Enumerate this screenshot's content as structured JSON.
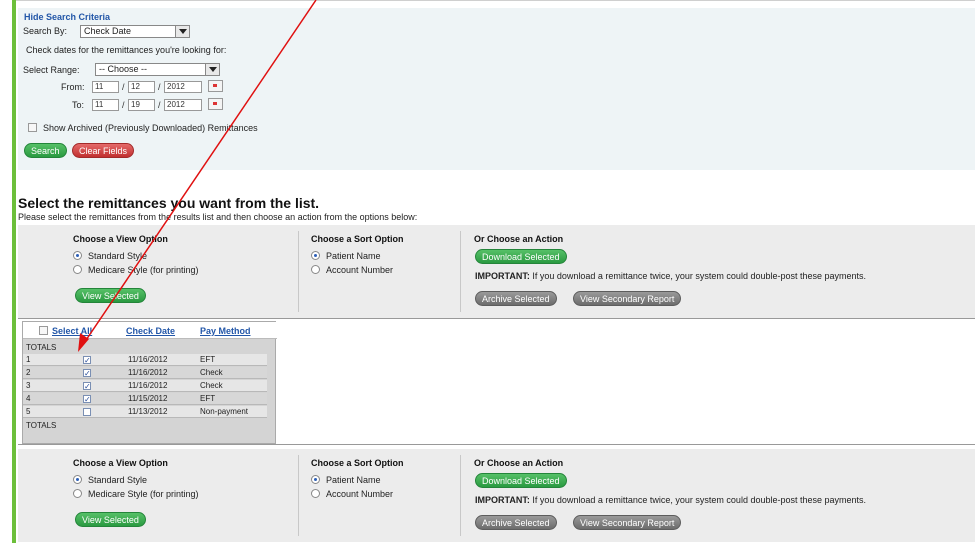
{
  "search": {
    "hide_link": "Hide Search Criteria",
    "search_by_label": "Search By:",
    "search_by_value": "Check Date",
    "check_dates_text": "Check dates for the remittances you're looking for:",
    "select_range_label": "Select Range:",
    "select_range_value": "-- Choose --",
    "from_label": "From:",
    "to_label": "To:",
    "from_month": "11",
    "from_day": "12",
    "from_year": "2012",
    "to_month": "11",
    "to_day": "19",
    "to_year": "2012",
    "slash": "/",
    "archived_label": "Show Archived (Previously Downloaded) Remittances",
    "search_button": "Search",
    "clear_button": "Clear Fields"
  },
  "section": {
    "title": "Select the remittances you want from the list.",
    "subtitle": "Please select the remittances from the results list and then choose an action from the options below:"
  },
  "options": {
    "view_heading": "Choose a View Option",
    "view_options": [
      "Standard Style",
      "Medicare Style (for printing)"
    ],
    "view_button": "View Selected",
    "sort_heading": "Choose a Sort Option",
    "sort_options": [
      "Patient Name",
      "Account Number"
    ],
    "action_heading": "Or Choose an Action",
    "download_button": "Download Selected",
    "important_label": "IMPORTANT:",
    "important_text": "If you download a remittance twice, your system could double-post these payments.",
    "archive_button": "Archive Selected",
    "secondary_button": "View Secondary Report"
  },
  "results": {
    "select_all": "Select All",
    "col_check_date": "Check Date",
    "col_pay_method": "Pay Method",
    "totals_label": "TOTALS",
    "rows": [
      {
        "num": "1",
        "checked": true,
        "date": "11/16/2012",
        "method": "EFT"
      },
      {
        "num": "2",
        "checked": true,
        "date": "11/16/2012",
        "method": "Check"
      },
      {
        "num": "3",
        "checked": true,
        "date": "11/16/2012",
        "method": "Check"
      },
      {
        "num": "4",
        "checked": true,
        "date": "11/15/2012",
        "method": "EFT"
      },
      {
        "num": "5",
        "checked": false,
        "date": "11/13/2012",
        "method": "Non-payment"
      }
    ]
  },
  "colors": {
    "accent_green": "#6cbf3a",
    "link_blue": "#2256a8",
    "annotation_red": "#e01010"
  }
}
